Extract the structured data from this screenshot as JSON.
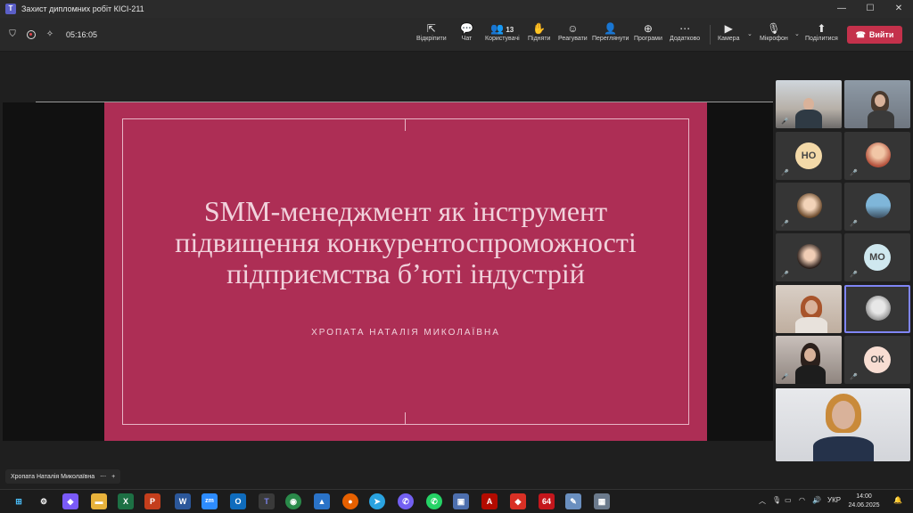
{
  "window": {
    "title": "Захист дипломних робіт КІСІ-211",
    "controls": [
      "—",
      "☐",
      "✕"
    ]
  },
  "toolbar": {
    "timer": "05:16:05",
    "buttons": [
      {
        "label": "Відкріпити",
        "icon": "unpin-icon",
        "glyph": "⇱"
      },
      {
        "label": "Чат",
        "icon": "chat-icon",
        "glyph": "💬"
      },
      {
        "label": "Користувачі",
        "icon": "people-icon",
        "glyph": "👥",
        "count": "13"
      },
      {
        "label": "Підняти",
        "icon": "raise-hand-icon",
        "glyph": "✋"
      },
      {
        "label": "Реагувати",
        "icon": "react-icon",
        "glyph": "☺"
      },
      {
        "label": "Переглянути",
        "icon": "view-icon",
        "glyph": "👤"
      },
      {
        "label": "Програми",
        "icon": "apps-icon",
        "glyph": "⊕"
      },
      {
        "label": "Додатково",
        "icon": "more-icon",
        "glyph": "⋯"
      },
      {
        "label": "Камера",
        "icon": "camera-icon",
        "glyph": "▶"
      },
      {
        "label": "Мікрофон",
        "icon": "microphone-icon",
        "glyph": "🎙"
      },
      {
        "label": "Поділитися",
        "icon": "share-icon",
        "glyph": "⬆"
      }
    ],
    "leave_label": "Вийти",
    "leave_color": "#c4314b"
  },
  "slide": {
    "title": "SMM-менеджмент як інструмент підвищення конкурентоспроможності підприємства б’юті індустрій",
    "author": "ХРОПАТА НАТАЛІЯ МИКОЛАЇВНА",
    "background": "#ad2e55"
  },
  "participants": {
    "initials": [
      "НО",
      "МО",
      "ОК"
    ]
  },
  "presenter_tag": {
    "name": "Хропата Наталія Миколаївна",
    "more": "⋯",
    "add": "+"
  },
  "taskbar": {
    "language": "УКР",
    "time": "14:00",
    "date": "24.06.2025",
    "badge": "64"
  }
}
